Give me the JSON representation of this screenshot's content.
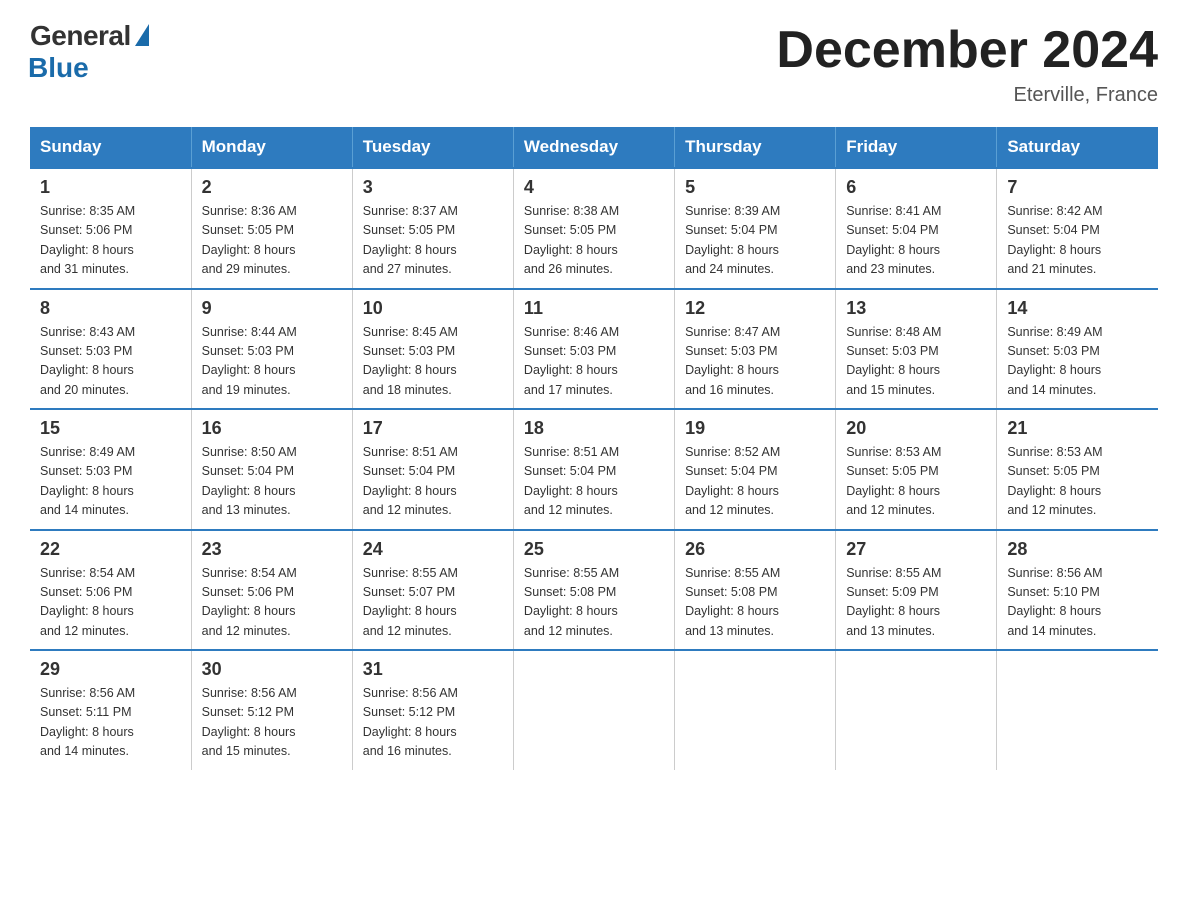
{
  "logo": {
    "general": "General",
    "blue": "Blue"
  },
  "title": {
    "month_year": "December 2024",
    "location": "Eterville, France"
  },
  "days_of_week": [
    "Sunday",
    "Monday",
    "Tuesday",
    "Wednesday",
    "Thursday",
    "Friday",
    "Saturday"
  ],
  "weeks": [
    [
      {
        "day": "1",
        "sunrise": "8:35 AM",
        "sunset": "5:06 PM",
        "daylight": "8 hours and 31 minutes."
      },
      {
        "day": "2",
        "sunrise": "8:36 AM",
        "sunset": "5:05 PM",
        "daylight": "8 hours and 29 minutes."
      },
      {
        "day": "3",
        "sunrise": "8:37 AM",
        "sunset": "5:05 PM",
        "daylight": "8 hours and 27 minutes."
      },
      {
        "day": "4",
        "sunrise": "8:38 AM",
        "sunset": "5:05 PM",
        "daylight": "8 hours and 26 minutes."
      },
      {
        "day": "5",
        "sunrise": "8:39 AM",
        "sunset": "5:04 PM",
        "daylight": "8 hours and 24 minutes."
      },
      {
        "day": "6",
        "sunrise": "8:41 AM",
        "sunset": "5:04 PM",
        "daylight": "8 hours and 23 minutes."
      },
      {
        "day": "7",
        "sunrise": "8:42 AM",
        "sunset": "5:04 PM",
        "daylight": "8 hours and 21 minutes."
      }
    ],
    [
      {
        "day": "8",
        "sunrise": "8:43 AM",
        "sunset": "5:03 PM",
        "daylight": "8 hours and 20 minutes."
      },
      {
        "day": "9",
        "sunrise": "8:44 AM",
        "sunset": "5:03 PM",
        "daylight": "8 hours and 19 minutes."
      },
      {
        "day": "10",
        "sunrise": "8:45 AM",
        "sunset": "5:03 PM",
        "daylight": "8 hours and 18 minutes."
      },
      {
        "day": "11",
        "sunrise": "8:46 AM",
        "sunset": "5:03 PM",
        "daylight": "8 hours and 17 minutes."
      },
      {
        "day": "12",
        "sunrise": "8:47 AM",
        "sunset": "5:03 PM",
        "daylight": "8 hours and 16 minutes."
      },
      {
        "day": "13",
        "sunrise": "8:48 AM",
        "sunset": "5:03 PM",
        "daylight": "8 hours and 15 minutes."
      },
      {
        "day": "14",
        "sunrise": "8:49 AM",
        "sunset": "5:03 PM",
        "daylight": "8 hours and 14 minutes."
      }
    ],
    [
      {
        "day": "15",
        "sunrise": "8:49 AM",
        "sunset": "5:03 PM",
        "daylight": "8 hours and 14 minutes."
      },
      {
        "day": "16",
        "sunrise": "8:50 AM",
        "sunset": "5:04 PM",
        "daylight": "8 hours and 13 minutes."
      },
      {
        "day": "17",
        "sunrise": "8:51 AM",
        "sunset": "5:04 PM",
        "daylight": "8 hours and 12 minutes."
      },
      {
        "day": "18",
        "sunrise": "8:51 AM",
        "sunset": "5:04 PM",
        "daylight": "8 hours and 12 minutes."
      },
      {
        "day": "19",
        "sunrise": "8:52 AM",
        "sunset": "5:04 PM",
        "daylight": "8 hours and 12 minutes."
      },
      {
        "day": "20",
        "sunrise": "8:53 AM",
        "sunset": "5:05 PM",
        "daylight": "8 hours and 12 minutes."
      },
      {
        "day": "21",
        "sunrise": "8:53 AM",
        "sunset": "5:05 PM",
        "daylight": "8 hours and 12 minutes."
      }
    ],
    [
      {
        "day": "22",
        "sunrise": "8:54 AM",
        "sunset": "5:06 PM",
        "daylight": "8 hours and 12 minutes."
      },
      {
        "day": "23",
        "sunrise": "8:54 AM",
        "sunset": "5:06 PM",
        "daylight": "8 hours and 12 minutes."
      },
      {
        "day": "24",
        "sunrise": "8:55 AM",
        "sunset": "5:07 PM",
        "daylight": "8 hours and 12 minutes."
      },
      {
        "day": "25",
        "sunrise": "8:55 AM",
        "sunset": "5:08 PM",
        "daylight": "8 hours and 12 minutes."
      },
      {
        "day": "26",
        "sunrise": "8:55 AM",
        "sunset": "5:08 PM",
        "daylight": "8 hours and 13 minutes."
      },
      {
        "day": "27",
        "sunrise": "8:55 AM",
        "sunset": "5:09 PM",
        "daylight": "8 hours and 13 minutes."
      },
      {
        "day": "28",
        "sunrise": "8:56 AM",
        "sunset": "5:10 PM",
        "daylight": "8 hours and 14 minutes."
      }
    ],
    [
      {
        "day": "29",
        "sunrise": "8:56 AM",
        "sunset": "5:11 PM",
        "daylight": "8 hours and 14 minutes."
      },
      {
        "day": "30",
        "sunrise": "8:56 AM",
        "sunset": "5:12 PM",
        "daylight": "8 hours and 15 minutes."
      },
      {
        "day": "31",
        "sunrise": "8:56 AM",
        "sunset": "5:12 PM",
        "daylight": "8 hours and 16 minutes."
      },
      null,
      null,
      null,
      null
    ]
  ],
  "labels": {
    "sunrise": "Sunrise:",
    "sunset": "Sunset:",
    "daylight": "Daylight:"
  }
}
